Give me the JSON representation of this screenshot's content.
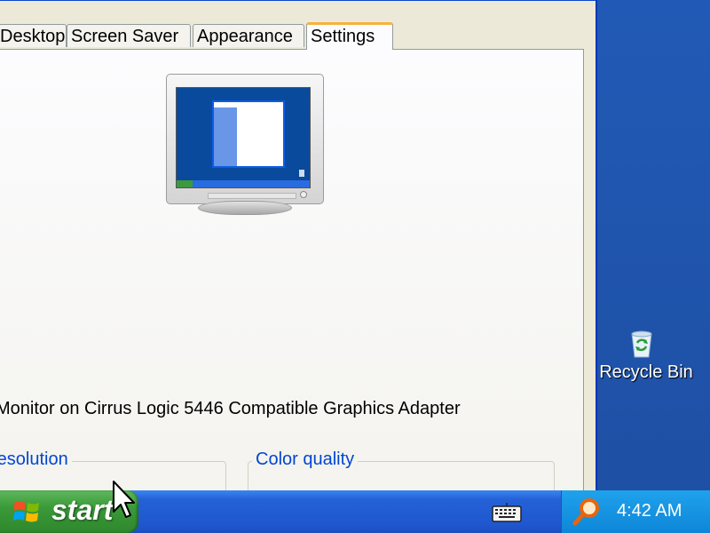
{
  "window": {
    "tabs": [
      "Desktop",
      "Screen Saver",
      "Appearance",
      "Settings"
    ],
    "active_tab": "Settings",
    "display_label": "Monitor on Cirrus Logic 5446 Compatible Graphics Adapter",
    "resolution_group_label": "resolution",
    "color_quality_group_label": "Color quality"
  },
  "desktop": {
    "icons": [
      {
        "label": "Recycle Bin",
        "icon": "recycle-bin-icon"
      }
    ]
  },
  "taskbar": {
    "start_label": "start",
    "tray_icons": [
      "keyboard-icon",
      "magnifier-icon"
    ],
    "clock": "4:42 AM"
  },
  "colors": {
    "desktop_blue": "#2b5fb4",
    "taskbar_blue": "#2462d8",
    "start_green": "#3a9a38",
    "tray_blue": "#1fa2ec",
    "active_tab_accent": "#f5b23c",
    "group_label_blue": "#0046d5"
  }
}
